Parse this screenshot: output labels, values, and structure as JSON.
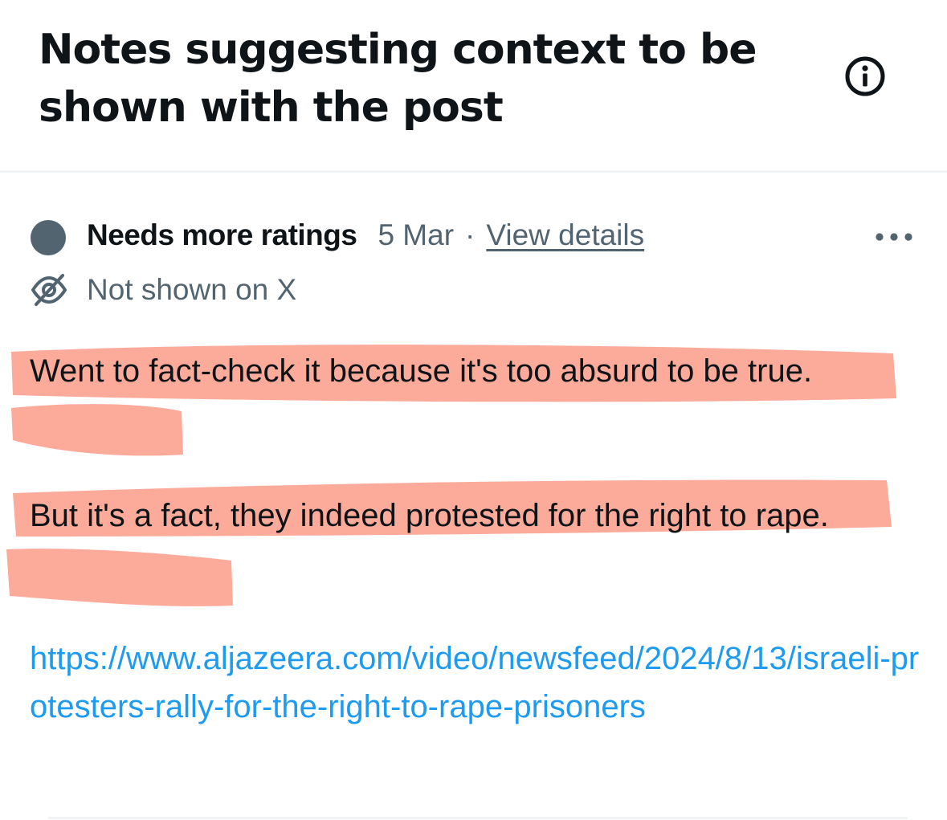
{
  "header": {
    "title": "Notes suggesting context to be shown with the post",
    "info_icon": "info-circle-icon"
  },
  "note": {
    "status_label": "Needs more ratings",
    "status_color": "#536471",
    "date": "5 Mar",
    "separator": "·",
    "details_link": "View details",
    "more_icon": "more-horizontal-icon",
    "visibility_icon": "eye-off-icon",
    "visibility_text": "Not shown on X",
    "paragraphs": [
      "Went to fact-check it because it's too absurd to be true.",
      "But it's a fact, they indeed protested for the right to rape."
    ],
    "link": "https://www.aljazeera.com/video/newsfeed/2024/8/13/israeli-protesters-rally-for-the-right-to-rape-prisoners",
    "highlight_color": "#fca493"
  },
  "colors": {
    "text_primary": "#0f1419",
    "text_secondary": "#536471",
    "link": "#1d9bf0",
    "divider": "#eff3f4"
  }
}
